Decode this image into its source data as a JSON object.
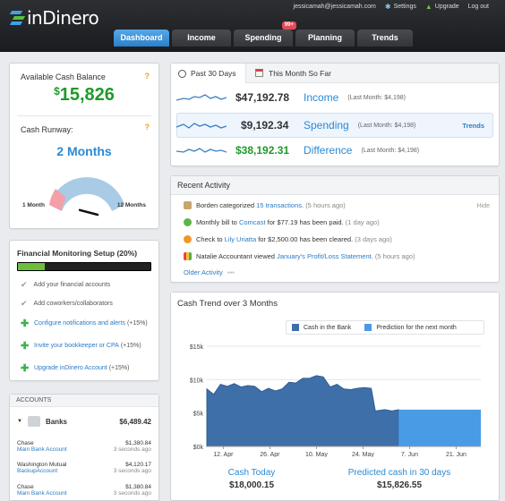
{
  "app": {
    "brand": "inDinero",
    "user_email": "jessicamah@jessicamah.com",
    "settings_label": "Settings",
    "upgrade_label": "Upgrade",
    "logout_label": "Log out"
  },
  "tabs": [
    {
      "label": "Dashboard",
      "active": true
    },
    {
      "label": "Income"
    },
    {
      "label": "Spending",
      "badge": "99+"
    },
    {
      "label": "Planning"
    },
    {
      "label": "Trends"
    }
  ],
  "cash_balance": {
    "title": "Available Cash Balance",
    "help": "?",
    "currency": "$",
    "amount": "15,826"
  },
  "runway": {
    "title": "Cash Runway:",
    "help": "?",
    "value": "2 Months",
    "min_label": "1 Month",
    "max_label": "12 Months",
    "needle_fraction": 0.1
  },
  "monitoring": {
    "title": "Financial Monitoring Setup (20%)",
    "progress_fraction": 0.2,
    "steps": [
      {
        "label": "Add your financial accounts",
        "done": true
      },
      {
        "label": "Add coworkers/collaborators",
        "done": true
      },
      {
        "label": "Configure notifications and alerts",
        "bonus": "(+15%)",
        "done": false
      },
      {
        "label": "Invite your bookkeeper or CPA",
        "bonus": "(+15%)",
        "done": false
      },
      {
        "label": "Upgrade inDinero Account",
        "bonus": "(+15%)",
        "done": false
      }
    ]
  },
  "accounts": {
    "title": "ACCOUNTS",
    "group": {
      "label": "Banks",
      "total": "$6,489.42"
    },
    "items": [
      {
        "bank": "Chase",
        "name": "Main Bank Account",
        "amount": "$1,380.84",
        "updated": "3 seconds ago"
      },
      {
        "bank": "Washington Mutual",
        "name": "BackupAccount",
        "amount": "$4,120.17",
        "updated": "3 seconds ago"
      },
      {
        "bank": "Chase",
        "name": "Main Bank Account",
        "amount": "$1,380.84",
        "updated": "3 seconds ago"
      }
    ]
  },
  "summary": {
    "period_tabs": [
      {
        "label": "Past 30 Days",
        "active": true
      },
      {
        "label": "This Month So Far"
      }
    ],
    "rows": [
      {
        "amount": "$47,192.78",
        "label": "Income",
        "last": "(Last Month: $4,198)"
      },
      {
        "amount": "$9,192.34",
        "label": "Spending",
        "last": "(Last Month: $4,198)",
        "link": "Trends"
      },
      {
        "amount": "$38,192.31",
        "label": "Difference",
        "last": "(Last Month: $4,198)"
      }
    ]
  },
  "activity": {
    "title": "Recent Activity",
    "hide_label": "Hide",
    "items": [
      {
        "pre": "Borden categorized ",
        "link": "15 transactions.",
        "post": "",
        "ago": "(5 hours ago)"
      },
      {
        "pre": "Monthly bill to ",
        "link": "Comcast",
        "post": " for $77.19 has been paid.",
        "ago": "(1 day ago)"
      },
      {
        "pre": "Check to ",
        "link": "Lily Uriatta",
        "post": " for $2,500.00 has been cleared.",
        "ago": "(3 days ago)"
      },
      {
        "pre": "Natalie Accountant viewed ",
        "link": "January's Profit/Loss Statement.",
        "post": "",
        "ago": "(5 hours ago)"
      }
    ],
    "older_label": "Older Activity"
  },
  "cash_trend": {
    "title": "Cash Trend over 3 Months",
    "today_label": "Cash Today",
    "today_value": "$18,000.15",
    "pred_label": "Predicted cash in 30 days",
    "pred_value": "$15,826.55"
  },
  "chart_data": {
    "type": "area",
    "series": [
      {
        "name": "Cash in the Bank",
        "color": "#3f6fa8"
      },
      {
        "name": "Prediction for the next month",
        "color": "#4a9be6"
      }
    ],
    "y_ticks": [
      "$15k",
      "$10k",
      "$5k",
      "$0k"
    ],
    "x_ticks": [
      "12. Apr",
      "26. Apr",
      "10. May",
      "24. May",
      "7. Jun",
      "21. Jun"
    ],
    "ylim": [
      0,
      15000
    ],
    "actual": [
      [
        0,
        8600
      ],
      [
        0.5,
        7800
      ],
      [
        1,
        9300
      ],
      [
        1.5,
        9000
      ],
      [
        2,
        9400
      ],
      [
        2.5,
        8900
      ],
      [
        3,
        9100
      ],
      [
        3.5,
        9000
      ],
      [
        4,
        8200
      ],
      [
        4.5,
        8700
      ],
      [
        5,
        8300
      ],
      [
        5.5,
        8600
      ],
      [
        6,
        9600
      ],
      [
        6.5,
        9500
      ],
      [
        7,
        10200
      ],
      [
        7.5,
        10200
      ],
      [
        8,
        10600
      ],
      [
        8.5,
        10400
      ],
      [
        9,
        8900
      ],
      [
        9.5,
        9300
      ],
      [
        10,
        8600
      ],
      [
        10.5,
        8500
      ],
      [
        11,
        8700
      ],
      [
        11.5,
        8800
      ],
      [
        12,
        8700
      ],
      [
        12.3,
        5300
      ],
      [
        13,
        5500
      ],
      [
        13.5,
        5300
      ],
      [
        14,
        5500
      ]
    ],
    "prediction": [
      [
        14,
        5500
      ],
      [
        20,
        5500
      ]
    ],
    "x_tick_positions": [
      1.2,
      4.6,
      8,
      11.4,
      14.8,
      18.2
    ]
  }
}
